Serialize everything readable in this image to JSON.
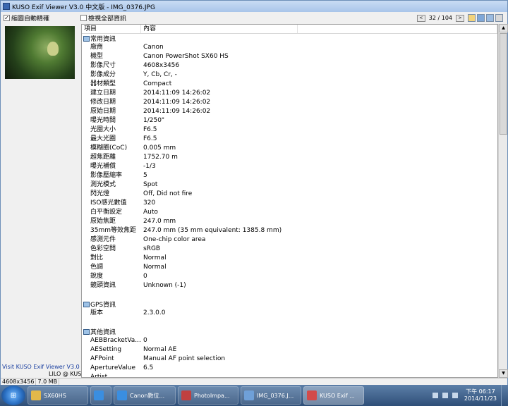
{
  "window": {
    "title": "KUSO Exif Viewer V3.0 中文版 - IMG_0376.JPG"
  },
  "toolbar": {
    "thumb_fit_label": "縮圖自動精確",
    "thumb_fit_checked": "✓",
    "show_all_label": "檢視全部資訊",
    "prev": "<",
    "next": ">",
    "page": "32 / 104"
  },
  "table": {
    "col_item": "項目",
    "col_content": "內容",
    "groups": [
      {
        "name": "常用資訊",
        "rows": [
          [
            "廠商",
            "Canon"
          ],
          [
            "機型",
            "Canon PowerShot SX60 HS"
          ],
          [
            "影像尺寸",
            "4608x3456"
          ],
          [
            "影像成分",
            "Y, Cb, Cr, -"
          ],
          [
            "器材類型",
            "Compact"
          ],
          [
            "建立日期",
            "2014:11:09 14:26:02"
          ],
          [
            "修改日期",
            "2014:11:09 14:26:02"
          ],
          [
            "原始日期",
            "2014:11:09 14:26:02"
          ],
          [
            "曝光時間",
            "1/250\""
          ],
          [
            "光圈大小",
            "F6.5"
          ],
          [
            "最大光圈",
            "F6.5"
          ],
          [
            "模糊圈(CoC)",
            "0.005 mm"
          ],
          [
            "超焦距離",
            "1752.70 m"
          ],
          [
            "曝光補償",
            "-1/3"
          ],
          [
            "影像壓縮率",
            "5"
          ],
          [
            "測光模式",
            "Spot"
          ],
          [
            "閃光燈",
            "Off, Did not fire"
          ],
          [
            "ISO感光數值",
            "320"
          ],
          [
            "白平衡設定",
            "Auto"
          ],
          [
            "原始焦距",
            "247.0 mm"
          ],
          [
            "35mm等效焦距",
            "247.0 mm (35 mm equivalent: 1385.8 mm)"
          ],
          [
            "感測元件",
            "One-chip color area"
          ],
          [
            "色彩空間",
            "sRGB"
          ],
          [
            "對比",
            "Normal"
          ],
          [
            "色調",
            "Normal"
          ],
          [
            "銳度",
            "0"
          ],
          [
            "鏡頭資訊",
            "Unknown (-1)"
          ]
        ]
      },
      {
        "name": "GPS資訊",
        "rows": [
          [
            "版本",
            "2.3.0.0"
          ]
        ]
      },
      {
        "name": "其他資訊",
        "rows": [
          [
            "AEBBracketVa...",
            "0"
          ],
          [
            "AESetting",
            "Normal AE"
          ],
          [
            "AFPoint",
            "Manual AF point selection"
          ],
          [
            "ApertureValue",
            "6.5"
          ],
          [
            "Artist",
            ""
          ]
        ]
      }
    ]
  },
  "left_panel": {
    "visit_link": "Visit KUSO Exif Viewer V3.0",
    "credit": "LILO @ KUSO..."
  },
  "status": {
    "dimensions": "4608x3456",
    "size": "7.0 MB"
  },
  "taskbar": {
    "start": "⊞",
    "items": [
      {
        "label": "SX60HS",
        "color": "#e3b84a",
        "active": false,
        "width": 86
      },
      {
        "label": "",
        "color": "#3a8ee0",
        "active": false,
        "width": 30
      },
      {
        "label": "Canon數位...",
        "color": "#3a8ee0",
        "active": false,
        "width": 88
      },
      {
        "label": "PhotoImpa...",
        "color": "#c04040",
        "active": false,
        "width": 86
      },
      {
        "label": "IMG_0376.J...",
        "color": "#6fa0d8",
        "active": false,
        "width": 86
      },
      {
        "label": "KUSO Exif ...",
        "color": "#d24a4a",
        "active": true,
        "width": 86
      }
    ],
    "clock_label": "下午 06:17",
    "date_label": "2014/11/23"
  }
}
